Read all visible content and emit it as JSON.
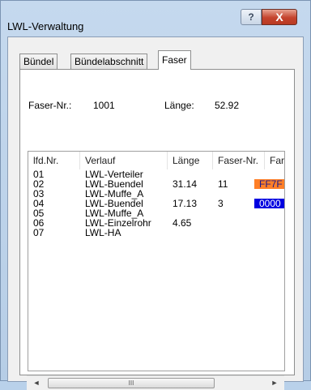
{
  "window": {
    "title": "LWL-Verwaltung",
    "help_label": "?",
    "close_label": "X"
  },
  "tabs": [
    {
      "label": "Bündel",
      "active": false
    },
    {
      "label": "Bündelabschnitt",
      "active": false
    },
    {
      "label": "Faser",
      "active": true
    }
  ],
  "info": {
    "faser_nr_label": "Faser-Nr.:",
    "faser_nr_value": "1001",
    "laenge_label": "Länge:",
    "laenge_value": "52.92"
  },
  "table": {
    "columns": [
      "lfd.Nr.",
      "Verlauf",
      "Länge",
      "Faser-Nr.",
      "Farb"
    ],
    "rows": [
      {
        "nr": "01",
        "verlauf": "LWL-Verteiler",
        "laenge": "",
        "faser": "",
        "farbe": "",
        "farbe_bg": ""
      },
      {
        "nr": "02",
        "verlauf": "LWL-Buendel",
        "laenge": "31.14",
        "faser": "11",
        "farbe": "FF7F",
        "farbe_bg": "#ff7f27",
        "farbe_fg": "#1a1a8c"
      },
      {
        "nr": "03",
        "verlauf": "LWL-Muffe_A",
        "laenge": "",
        "faser": "",
        "farbe": "",
        "farbe_bg": ""
      },
      {
        "nr": "04",
        "verlauf": "LWL-Buendel",
        "laenge": "17.13",
        "faser": "3",
        "farbe": "0000",
        "farbe_bg": "#0000e0",
        "farbe_fg": "#ffffff"
      },
      {
        "nr": "05",
        "verlauf": "LWL-Muffe_A",
        "laenge": "",
        "faser": "",
        "farbe": "",
        "farbe_bg": ""
      },
      {
        "nr": "06",
        "verlauf": "LWL-Einzelrohr",
        "laenge": "4.65",
        "faser": "",
        "farbe": "",
        "farbe_bg": ""
      },
      {
        "nr": "07",
        "verlauf": "LWL-HA",
        "laenge": "",
        "faser": "",
        "farbe": "",
        "farbe_bg": ""
      }
    ]
  },
  "scrollbar": {
    "left_arrow": "◄",
    "right_arrow": "►",
    "grip": "III"
  },
  "colors": {
    "accent_close": "#c4432d",
    "frame": "#b9d1ea"
  }
}
